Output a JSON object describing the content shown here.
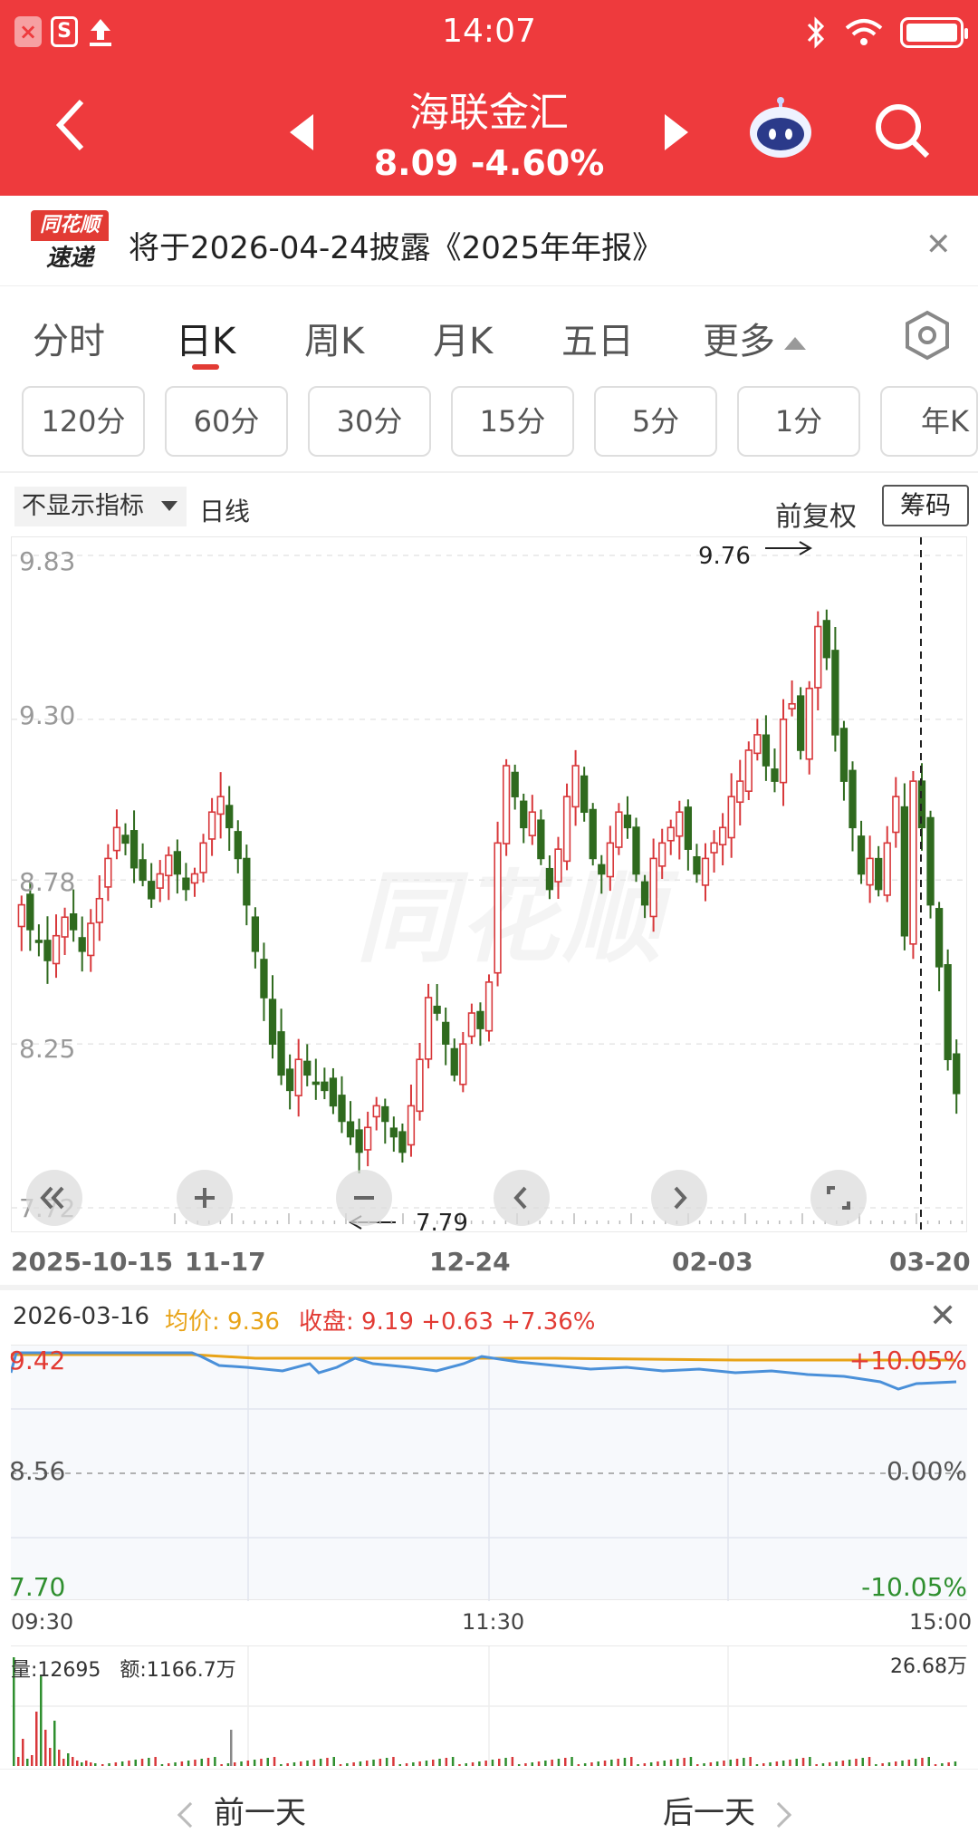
{
  "status": {
    "time": "14:07",
    "left_icons": [
      "close-badge-icon",
      "s-badge-icon",
      "upload-icon"
    ],
    "right_icons": [
      "bluetooth-icon",
      "wifi-icon",
      "battery-icon"
    ]
  },
  "header": {
    "name": "海联金汇",
    "price_line": "8.09 -4.60%",
    "bg_color": "#ee3a3d"
  },
  "notice": {
    "logo_top": "同花顺",
    "logo_bottom": "速递",
    "text": "将于2026-04-24披露《2025年年报》"
  },
  "tabs": [
    {
      "label": "分时",
      "active": false
    },
    {
      "label": "日K",
      "active": true
    },
    {
      "label": "周K",
      "active": false
    },
    {
      "label": "月K",
      "active": false
    },
    {
      "label": "五日",
      "active": false
    },
    {
      "label": "更多",
      "active": false
    }
  ],
  "periods": [
    "120分",
    "60分",
    "30分",
    "15分",
    "5分",
    "1分",
    "年K"
  ],
  "indicator": {
    "select_label": "不显示指标",
    "period_label": "日线",
    "adjust_label": "前复权",
    "chip_btn": "筹码"
  },
  "kchart": {
    "y_labels": [
      "9.83",
      "9.30",
      "8.78",
      "8.25",
      "7.72"
    ],
    "high_label": "9.76",
    "low_label": "7.79",
    "dates": [
      "2025-10-15",
      "11-17",
      "12-24",
      "02-03",
      "03-20"
    ],
    "up_color": "#d8383b",
    "down_color": "#2f6a1e",
    "watermark": "同花顺"
  },
  "chart_data": {
    "type": "candlestick",
    "ylim": [
      7.72,
      9.83
    ],
    "y_ticks": [
      9.83,
      9.3,
      8.78,
      8.25,
      7.72
    ],
    "x_ticks": [
      "2025-10-15",
      "11-17",
      "12-24",
      "02-03",
      "03-20"
    ],
    "high": 9.76,
    "low": 7.79,
    "close": [
      8.7,
      8.62,
      8.58,
      8.52,
      8.6,
      8.66,
      8.62,
      8.55,
      8.64,
      8.72,
      8.85,
      8.95,
      8.9,
      8.82,
      8.78,
      8.72,
      8.8,
      8.86,
      8.8,
      8.75,
      8.8,
      8.9,
      9.0,
      9.05,
      8.95,
      8.85,
      8.7,
      8.55,
      8.4,
      8.25,
      8.15,
      8.1,
      8.2,
      8.15,
      8.12,
      8.1,
      8.05,
      8.0,
      7.95,
      7.9,
      7.98,
      8.05,
      8.0,
      7.95,
      7.9,
      8.05,
      8.2,
      8.4,
      8.35,
      8.25,
      8.15,
      8.25,
      8.35,
      8.3,
      8.45,
      8.9,
      9.15,
      9.05,
      8.95,
      9.0,
      8.85,
      8.75,
      8.88,
      9.05,
      9.15,
      9.0,
      8.85,
      8.8,
      8.9,
      9.0,
      8.95,
      8.8,
      8.7,
      8.85,
      8.9,
      8.95,
      9.0,
      8.88,
      8.8,
      8.85,
      8.9,
      8.95,
      9.05,
      9.1,
      9.2,
      9.25,
      9.15,
      9.1,
      9.3,
      9.35,
      9.2,
      9.4,
      9.6,
      9.5,
      9.25,
      9.1,
      8.95,
      8.8,
      8.85,
      8.75,
      8.9,
      9.05,
      8.6,
      9.1,
      8.95,
      8.7,
      8.5,
      8.2,
      8.09
    ],
    "volume_note": "daily candles; up=red, down=green"
  },
  "detail": {
    "date": "2026-03-16",
    "avg_label": "均价: 9.36",
    "close_label": "收盘: 9.19 +0.63 +7.36%",
    "price_top": "9.42",
    "price_mid": "8.56",
    "price_bottom": "7.70",
    "pct_top": "+10.05%",
    "pct_mid": "0.00%",
    "pct_bottom": "-10.05%",
    "times": [
      "09:30",
      "11:30",
      "15:00"
    ],
    "volume_label": "量:12695",
    "amount_label": "额:1166.7万",
    "vol_max": "26.68万"
  },
  "footer": {
    "prev": "前一天",
    "next": "后一天"
  }
}
